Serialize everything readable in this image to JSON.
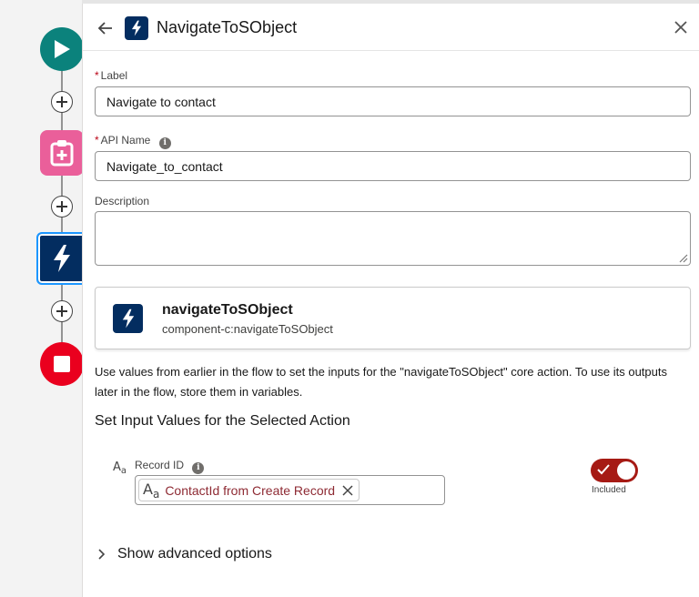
{
  "canvas": {
    "nodes": [
      {
        "type": "start",
        "icon": "play-icon",
        "color": "#0b827c"
      },
      {
        "type": "assignment",
        "icon": "clipboard-plus-icon",
        "color": "#ea5f9a"
      },
      {
        "type": "action",
        "icon": "lightning-icon",
        "color": "#032d60",
        "selected": true
      },
      {
        "type": "end",
        "icon": "stop-icon",
        "color": "#ea001e"
      }
    ],
    "add_button_icon": "plus-circle-icon"
  },
  "panel": {
    "title": "NavigateToSObject",
    "back_icon": "arrow-left-icon",
    "close_icon": "close-icon"
  },
  "form": {
    "label_field": {
      "required_mark": "*",
      "label": "Label",
      "value": "Navigate to contact"
    },
    "api_name_field": {
      "required_mark": "*",
      "label": "API Name",
      "value": "Navigate_to_contact",
      "info_icon": "i"
    },
    "description_field": {
      "label": "Description",
      "value": ""
    }
  },
  "action_card": {
    "name": "navigateToSObject",
    "component": "component-c:navigateToSObject"
  },
  "help_text": "Use values from earlier in the flow to set the inputs for the \"navigateToSObject\" core action. To use its outputs later in the flow, store them in variables.",
  "inputs": {
    "section_title": "Set Input Values for the Selected Action",
    "record_id": {
      "type_icon_text": "A",
      "type_icon_sub": "a",
      "label": "Record ID",
      "info_icon": "i",
      "pill_text": "ContactId from Create Record",
      "included": true,
      "included_label": "Included"
    }
  },
  "advanced": {
    "label": "Show advanced options"
  },
  "colors": {
    "brand_dark": "#032d60",
    "toggle_on": "#a61a14",
    "pill_text": "#8e2a33",
    "required": "#ba0517"
  }
}
